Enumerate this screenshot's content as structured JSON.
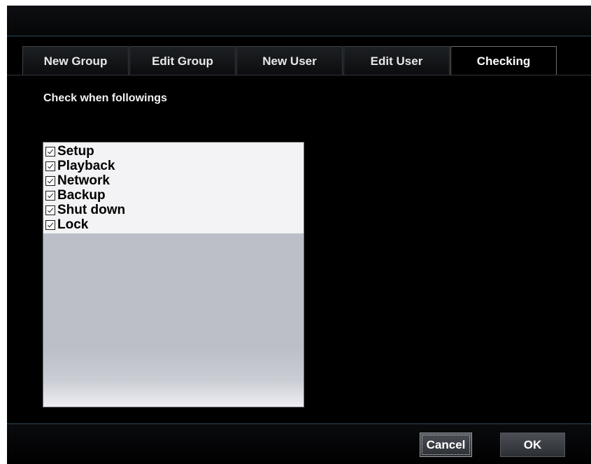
{
  "tabs": [
    {
      "label": "New Group",
      "active": false
    },
    {
      "label": "Edit Group",
      "active": false
    },
    {
      "label": "New User",
      "active": false
    },
    {
      "label": "Edit User",
      "active": false
    },
    {
      "label": "Checking",
      "active": true
    }
  ],
  "section_label": "Check when followings",
  "check_items": [
    {
      "label": "Setup",
      "checked": true
    },
    {
      "label": "Playback",
      "checked": true
    },
    {
      "label": "Network",
      "checked": true
    },
    {
      "label": "Backup",
      "checked": true
    },
    {
      "label": "Shut down",
      "checked": true
    },
    {
      "label": "Lock",
      "checked": true
    }
  ],
  "buttons": {
    "cancel_label": "Cancel",
    "ok_label": "OK"
  },
  "colors": {
    "background": "#000000",
    "accent_line": "#2d4a5a",
    "list_background": "#f3f3f5",
    "list_empty_area": "#bcbfc8"
  },
  "icons": {
    "checkbox": "checkbox-checked-icon"
  }
}
